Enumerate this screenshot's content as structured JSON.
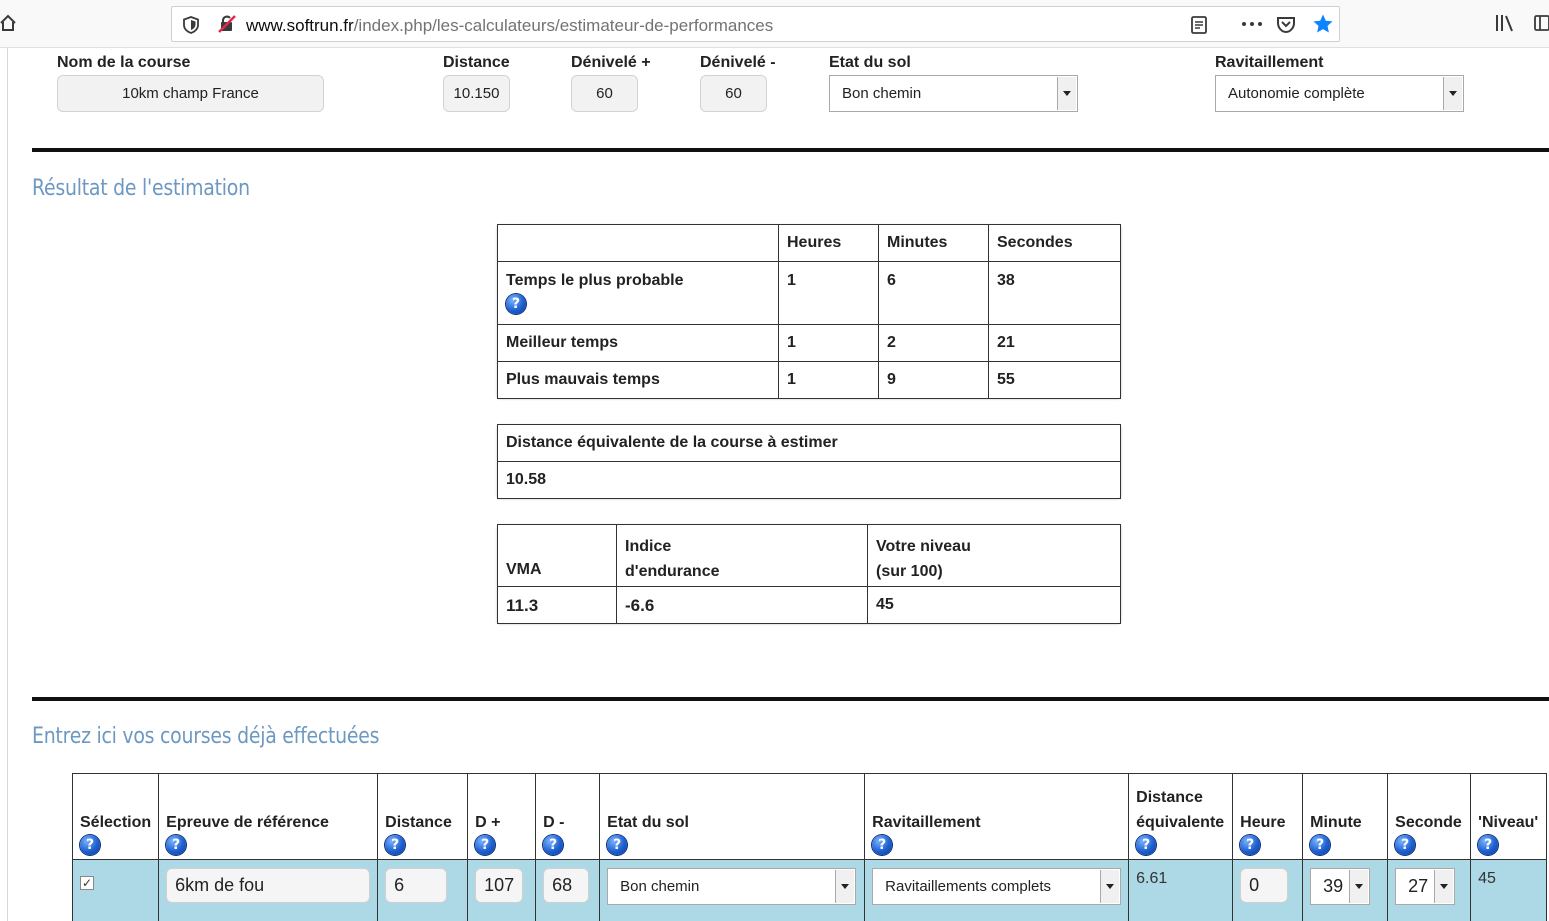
{
  "browser": {
    "url_host": "www.softrun.fr",
    "url_path": "/index.php/les-calculateurs/estimateur-de-performances",
    "icons": [
      "home-icon",
      "shield-icon",
      "no-connection-icon",
      "reader-view-icon",
      "more-icon",
      "pocket-icon",
      "bookmark-star-icon",
      "library-icon",
      "sidebar-icon"
    ],
    "accent": "#0a84ff"
  },
  "form": {
    "race_name_label": "Nom de la course",
    "race_name_value": "10km champ France",
    "distance_label": "Distance",
    "distance_value": "10.150",
    "dplus_label": "Dénivelé +",
    "dplus_value": "60",
    "dminus_label": "Dénivelé -",
    "dminus_value": "60",
    "ground_label": "Etat du sol",
    "ground_value": "Bon chemin",
    "supply_label": "Ravitaillement",
    "supply_value": "Autonomie complète"
  },
  "result": {
    "title": "Résultat de l'estimation",
    "headers": [
      "",
      "Heures",
      "Minutes",
      "Secondes"
    ],
    "rows": [
      {
        "label": "Temps le plus probable",
        "h": "1",
        "m": "6",
        "s": "38"
      },
      {
        "label": "Meilleur temps",
        "h": "1",
        "m": "2",
        "s": "21"
      },
      {
        "label": "Plus mauvais temps",
        "h": "1",
        "m": "9",
        "s": "55"
      }
    ],
    "equiv_label": "Distance équivalente de la course à estimer",
    "equiv_value": "10.58",
    "vma_label": "VMA",
    "endurance_label_1": "Indice",
    "endurance_label_2": "d'endurance",
    "level_label_1": "Votre niveau",
    "level_label_2": "(sur 100)",
    "vma_value": "11.3",
    "endurance_value": "-6.6",
    "level_value": "45"
  },
  "courses": {
    "title": "Entrez ici vos courses déjà effectuées",
    "help_glyph": "?",
    "check_glyph": "✓",
    "headers": {
      "selection": "Sélection",
      "epreuve": "Epreuve de référence",
      "distance": "Distance",
      "dplus": "D +",
      "dminus": "D -",
      "ground": "Etat du sol",
      "supply": "Ravitaillement",
      "equiv_1": "Distance",
      "equiv_2": "équivalente",
      "heure": "Heure",
      "minute": "Minute",
      "seconde": "Seconde",
      "niveau": "'Niveau'"
    },
    "rows": [
      {
        "selected": true,
        "epreuve": "6km de fou",
        "distance": "6",
        "dplus": "107",
        "dminus": "68",
        "ground": "Bon chemin",
        "supply": "Ravitaillements complets",
        "equiv": "6.61",
        "heure": "0",
        "minute": "39",
        "seconde": "27",
        "niveau": "45"
      }
    ],
    "row_color": "#add8e6"
  },
  "colors": {
    "section_title": "#6d98c2",
    "help_icon": "#1e5fd0"
  }
}
